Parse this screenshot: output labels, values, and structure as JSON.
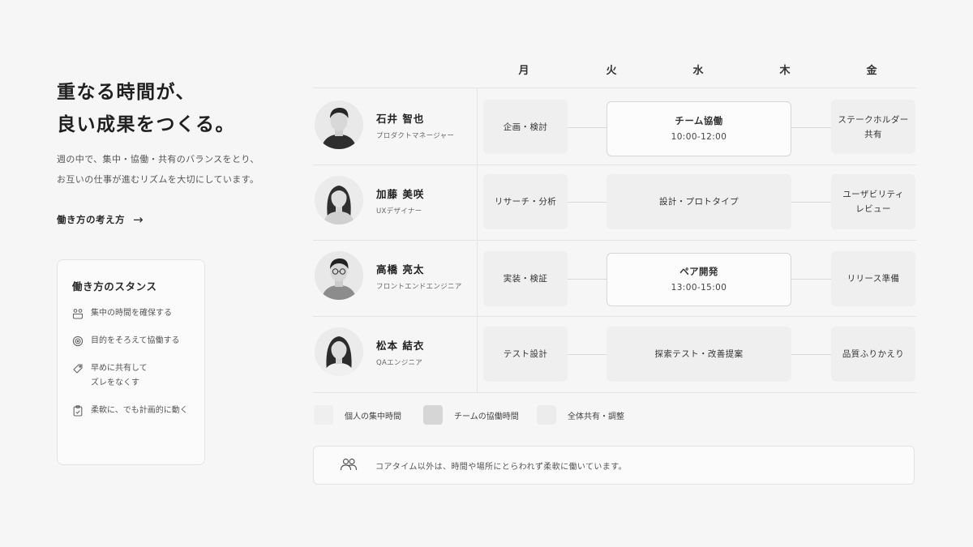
{
  "headline": {
    "line1": "重なる時間が、",
    "line2": "良い成果をつくる。"
  },
  "intro": {
    "line1": "週の中で、集中・協働・共有のバランスをとり、",
    "line2": "お互いの仕事が進むリズムを大切にしています。"
  },
  "link": {
    "label": "働き方の考え方",
    "arrow": "→"
  },
  "stance": {
    "title": "働き方のスタンス",
    "items": [
      {
        "icon": "focus-icon",
        "line1": "集中の時間を確保する",
        "line2": ""
      },
      {
        "icon": "target-icon",
        "line1": "目的をそろえて協働する",
        "line2": ""
      },
      {
        "icon": "tag-icon",
        "line1": "早めに共有して",
        "line2": "ズレをなくす"
      },
      {
        "icon": "clipboard-icon",
        "line1": "柔軟に、でも計画的に動く",
        "line2": ""
      }
    ]
  },
  "days": [
    "月",
    "火",
    "水",
    "木",
    "金"
  ],
  "members": [
    {
      "name": "石井 智也",
      "role": "プロダクトマネージャー"
    },
    {
      "name": "加藤 美咲",
      "role": "UXデザイナー"
    },
    {
      "name": "高橋 亮太",
      "role": "フロントエンドエンジニア"
    },
    {
      "name": "松本 結衣",
      "role": "QAエンジニア"
    }
  ],
  "schedule": [
    {
      "mon": "企画・検討",
      "mid_title": "チーム協働",
      "mid_time": "10:00-12:00",
      "fri_line1": "ステークホルダー",
      "fri_line2": "共有"
    },
    {
      "mon": "リサーチ・分析",
      "mid_title": "設計・プロトタイプ",
      "mid_time": "",
      "fri_line1": "ユーザビリティ",
      "fri_line2": "レビュー"
    },
    {
      "mon": "実装・検証",
      "mid_title": "ペア開発",
      "mid_time": "13:00-15:00",
      "fri_line1": "リリース準備",
      "fri_line2": ""
    },
    {
      "mon": "テスト設計",
      "mid_title": "探索テスト・改善提案",
      "mid_time": "",
      "fri_line1": "品質ふりかえり",
      "fri_line2": ""
    }
  ],
  "legend": [
    {
      "label": "個人の集中時間",
      "color": "#efefef"
    },
    {
      "label": "チームの協働時間",
      "color": "#d6d6d6"
    },
    {
      "label": "全体共有・調整",
      "color": "#ececec"
    }
  ],
  "note": {
    "icon": "people-icon",
    "text": "コアタイム以外は、時間や場所にとらわれず柔軟に働いています。"
  }
}
